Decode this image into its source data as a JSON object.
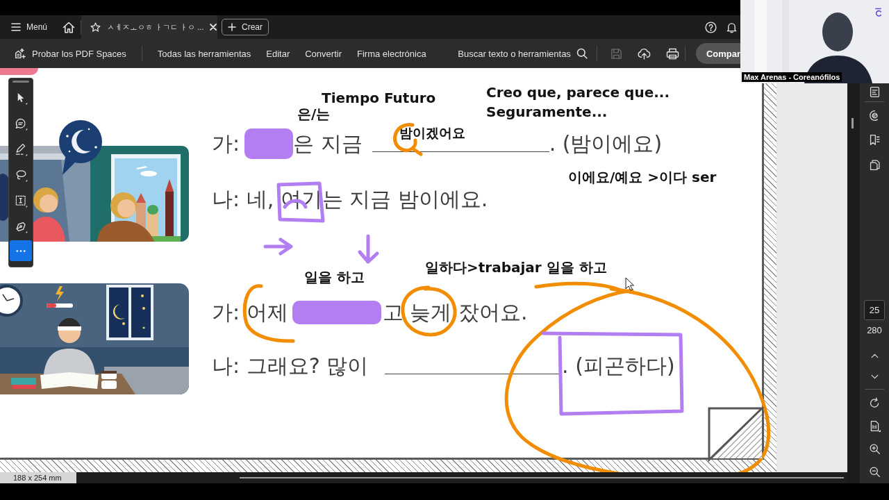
{
  "tab_bar": {
    "menu_label": "Menú",
    "tabs": [
      {
        "title": "ㅅㅔㅈㅗㅇㅎ ㅏㄱㄷ ㅏㅇ ...",
        "selected": true
      }
    ],
    "create_label": "Crear"
  },
  "toolbar": {
    "spaces_label": "Probar los PDF Spaces",
    "tools": [
      "Todas las herramientas",
      "Editar",
      "Convertir",
      "Firma electrónica"
    ],
    "search_label": "Buscar texto o herramientas",
    "actions": [
      {
        "kind": "save",
        "disabled": true
      },
      {
        "kind": "upload",
        "disabled": false
      },
      {
        "kind": "print",
        "disabled": false
      }
    ],
    "share_label": "Compar"
  },
  "webcam": {
    "name_tag": "Max Arenas - Coreanófilos"
  },
  "tool_panel": {
    "tools": [
      {
        "kind": "select",
        "selected": false
      },
      {
        "kind": "comment",
        "selected": false
      },
      {
        "kind": "draw",
        "selected": false
      },
      {
        "kind": "lasso",
        "selected": false
      },
      {
        "kind": "text-select",
        "selected": false
      },
      {
        "kind": "sign",
        "selected": false
      },
      {
        "kind": "more",
        "selected": true
      }
    ]
  },
  "document": {
    "exercises": [
      {
        "kind": "call",
        "lines": [
          {
            "segments": [
              {
                "kind": "text",
                "text": "가:"
              },
              {
                "kind": "covered"
              },
              {
                "kind": "text",
                "text": "은 지금"
              },
              {
                "kind": "blank"
              },
              {
                "kind": "text",
                "text": ". (밤이에요)"
              }
            ]
          },
          {
            "segments": [
              {
                "kind": "text",
                "text": "나: 네, "
              },
              {
                "kind": "text",
                "text": "여기"
              },
              {
                "kind": "text",
                "text": "는 지금 밤이에요."
              }
            ]
          }
        ]
      },
      {
        "kind": "study",
        "lines": [
          {
            "segments": [
              {
                "kind": "text",
                "text": "가: "
              },
              {
                "kind": "text",
                "text": "어제"
              },
              {
                "kind": "covered"
              },
              {
                "kind": "text",
                "text": "고 "
              },
              {
                "kind": "text",
                "text": "늦게"
              },
              {
                "kind": "text",
                "text": " 잤어요."
              }
            ]
          },
          {
            "segments": [
              {
                "kind": "text",
                "text": "나: 그래요? 많이"
              },
              {
                "kind": "blank"
              },
              {
                "kind": "text",
                "text": ". (피곤하다)"
              }
            ]
          }
        ]
      }
    ],
    "notes": [
      "Tiempo Futuro",
      "Creo que, parece que...",
      "은/는",
      "Seguramente...",
      "밤이겠어요",
      "이에요/예요 >이다 ser",
      "일을 하고",
      "일하다>trabajar 일을 하고"
    ]
  },
  "page_nav": {
    "page_number": "25",
    "page_count": "280"
  },
  "status_bar": {
    "page_size": "188 x 254 mm"
  }
}
